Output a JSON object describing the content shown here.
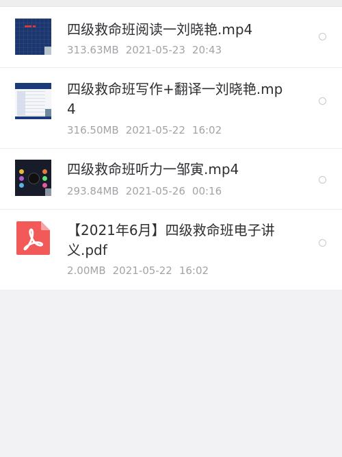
{
  "colors": {
    "background": "#f2f2f4",
    "row_background": "#ffffff",
    "title_text": "#2f2f33",
    "meta_text": "#a3a3a8",
    "pdf_red": "#f25a5a"
  },
  "files": [
    {
      "name": "四级救命班阅读一刘晓艳.mp4",
      "size": "313.63MB",
      "date": "2021-05-23",
      "time": "20:43",
      "icon": "video-thumbnail-icon"
    },
    {
      "name": "四级救命班写作+翻译一刘晓艳.mp4",
      "size": "316.50MB",
      "date": "2021-05-22",
      "time": "16:02",
      "icon": "video-thumbnail-icon"
    },
    {
      "name": "四级救命班听力一邹寅.mp4",
      "size": "293.84MB",
      "date": "2021-05-26",
      "time": "00:16",
      "icon": "video-thumbnail-icon"
    },
    {
      "name": "【2021年6月】四级救命班电子讲义.pdf",
      "size": "2.00MB",
      "date": "2021-05-22",
      "time": "16:02",
      "icon": "pdf-icon"
    }
  ]
}
